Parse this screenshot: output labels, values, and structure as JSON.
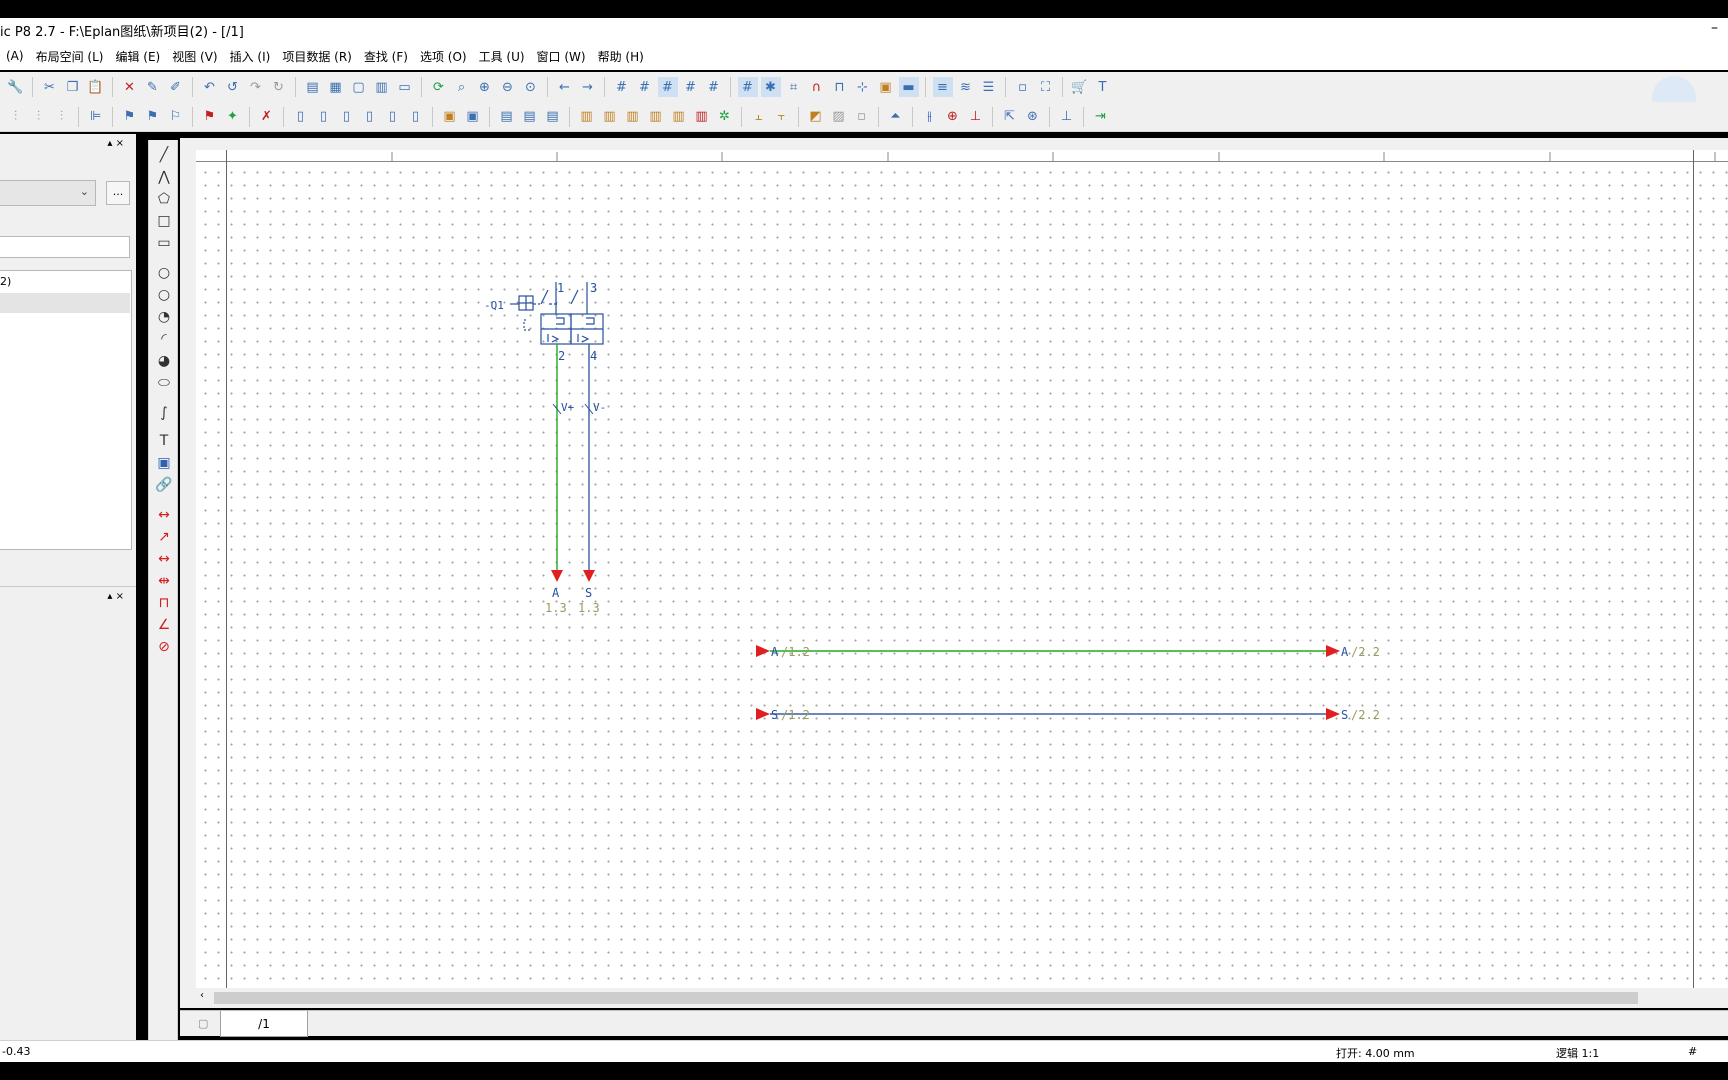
{
  "window": {
    "title": "ic P8 2.7 - F:\\Eplan图纸\\新项目(2) - [/1]",
    "minimize_glyph": "–"
  },
  "menu": [
    "(A)",
    "布局空间 (L)",
    "编辑 (E)",
    "视图 (V)",
    "插入 (I)",
    "项目数据 (R)",
    "查找 (F)",
    "选项 (O)",
    "工具 (U)",
    "窗口 (W)",
    "帮助 (H)"
  ],
  "left_panel": {
    "pin_close": "▴ ×",
    "dots_button": "...",
    "tree_item": "2)",
    "panel2_pin_close": "▴ ×"
  },
  "drawing": {
    "device_tag": "-Q1",
    "terminals_top": [
      "1",
      "3"
    ],
    "terminals_bottom": [
      "2",
      "4"
    ],
    "wire_labels": [
      "V+",
      "V-"
    ],
    "potential_endpoints": [
      {
        "name": "A",
        "ref": "1.3"
      },
      {
        "name": "S",
        "ref": "1.3"
      }
    ],
    "potential_lines": [
      {
        "left_label": "A",
        "left_ref": "/1.2",
        "right_label": "A",
        "right_ref": "/2.2",
        "color": "#22aa22"
      },
      {
        "left_label": "S",
        "left_ref": "/1.2",
        "right_label": "S",
        "right_ref": "/2.2",
        "color": "#3a5ea8"
      }
    ],
    "colors": {
      "green_wire": "#22aa22",
      "blue_wire": "#3a5ea8",
      "arrow": "#e02020",
      "symbol": "#2850a0",
      "ref_text": "#9a9a60"
    }
  },
  "page_tab": "/1",
  "status": {
    "coords": "-0.43",
    "grid": "打开: 4.00 mm",
    "scale": "逻辑 1:1",
    "hash": "#"
  }
}
